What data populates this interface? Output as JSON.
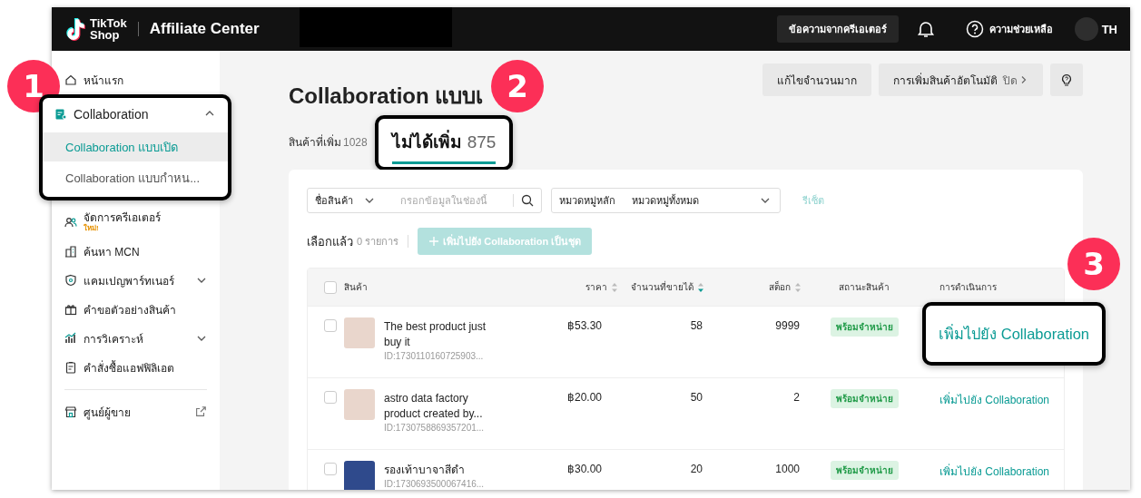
{
  "header": {
    "logo_top": "TikTok",
    "logo_bottom": "Shop",
    "app_name": "Affiliate Center",
    "messages_button": "ข้อความจากครีเอเตอร์",
    "help": "ความช่วยเหลือ",
    "user": "TH"
  },
  "sidebar": {
    "items": [
      {
        "label": "หน้าแรก",
        "kind": "link"
      },
      {
        "label": "Collaboration",
        "kind": "group",
        "expanded": true,
        "highlighted": true,
        "children": [
          {
            "label": "Collaboration แบบเปิด",
            "selected": true
          },
          {
            "label": "Collaboration แบบกำหน...",
            "selected": false
          }
        ]
      },
      {
        "label": "จัดการครีเอเตอร์",
        "kind": "link",
        "badge": "ใหม่!"
      },
      {
        "label": "ค้นหา MCN",
        "kind": "link"
      },
      {
        "label": "แคมเปญพาร์ทเนอร์",
        "kind": "group",
        "expanded": false
      },
      {
        "label": "คำขอตัวอย่างสินค้า",
        "kind": "link"
      },
      {
        "label": "การวิเคราะห์",
        "kind": "group",
        "expanded": false
      },
      {
        "label": "คำสั่งซื้อแอฟฟิลิเอต",
        "kind": "link"
      },
      {
        "label": "ศูนย์ผู้ขาย",
        "kind": "external"
      }
    ]
  },
  "page": {
    "title": "Collaboration แบบเ",
    "toolbar": {
      "bulk_edit": "แก้ไขจำนวนมาก",
      "auto_add": "การเพิ่มสินค้าอัตโนมัติ",
      "auto_add_state": "ปิด"
    },
    "tabs": [
      {
        "label": "สินค้าที่เพิ่ม",
        "count": "1028",
        "selected": false,
        "highlighted": false
      },
      {
        "label": "ไม่ได้เพิ่ม",
        "count": "875",
        "selected": true,
        "highlighted": true
      }
    ],
    "filters": {
      "field_select": "ชื่อสินค้า",
      "search_placeholder": "กรอกข้อมูลในช่องนี้",
      "category_label": "หมวดหมู่หลัก",
      "category_value": "หมวดหมู่ทั้งหมด",
      "reset": "รีเซ็ต"
    },
    "selection": {
      "label": "เลือกแล้ว",
      "count": "0 รายการ",
      "batch_button": "เพิ่มไปยัง Collaboration เป็นชุด",
      "batch_disabled": true
    }
  },
  "table": {
    "columns": [
      {
        "label": "สินค้า"
      },
      {
        "label": "ราคา",
        "sort_descending": false
      },
      {
        "label": "จำนวนที่ขายได้",
        "sort_descending": true
      },
      {
        "label": "สต็อก",
        "sort_descending": false
      },
      {
        "label": "สถานะสินค้า"
      },
      {
        "label": "การดำเนินการ"
      }
    ],
    "all_checked": false,
    "rows": [
      {
        "checked": false,
        "name": "The best product just buy it",
        "id": "ID:1730110160725903...",
        "price": "฿53.30",
        "sold": "58",
        "stock": "9999",
        "status": "พร้อมจำหน่าย",
        "action": "เพิ่มไปยัง Collaboration",
        "highlighted": true
      },
      {
        "checked": false,
        "name": "astro data factory product created by...",
        "id": "ID:1730758869357201...",
        "price": "฿20.00",
        "sold": "50",
        "stock": "2",
        "status": "พร้อมจำหน่าย",
        "action": "เพิ่มไปยัง Collaboration",
        "highlighted": false
      },
      {
        "checked": false,
        "name": "รองเท้าบาจาสีดำ",
        "id": "ID:1730693500067416...",
        "price": "฿30.00",
        "sold": "20",
        "stock": "1000",
        "status": "พร้อมจำหน่าย",
        "action": "เพิ่มไปยัง Collaboration",
        "highlighted": false
      }
    ]
  },
  "callouts": [
    {
      "number": "1"
    },
    {
      "number": "2"
    },
    {
      "number": "3"
    }
  ]
}
